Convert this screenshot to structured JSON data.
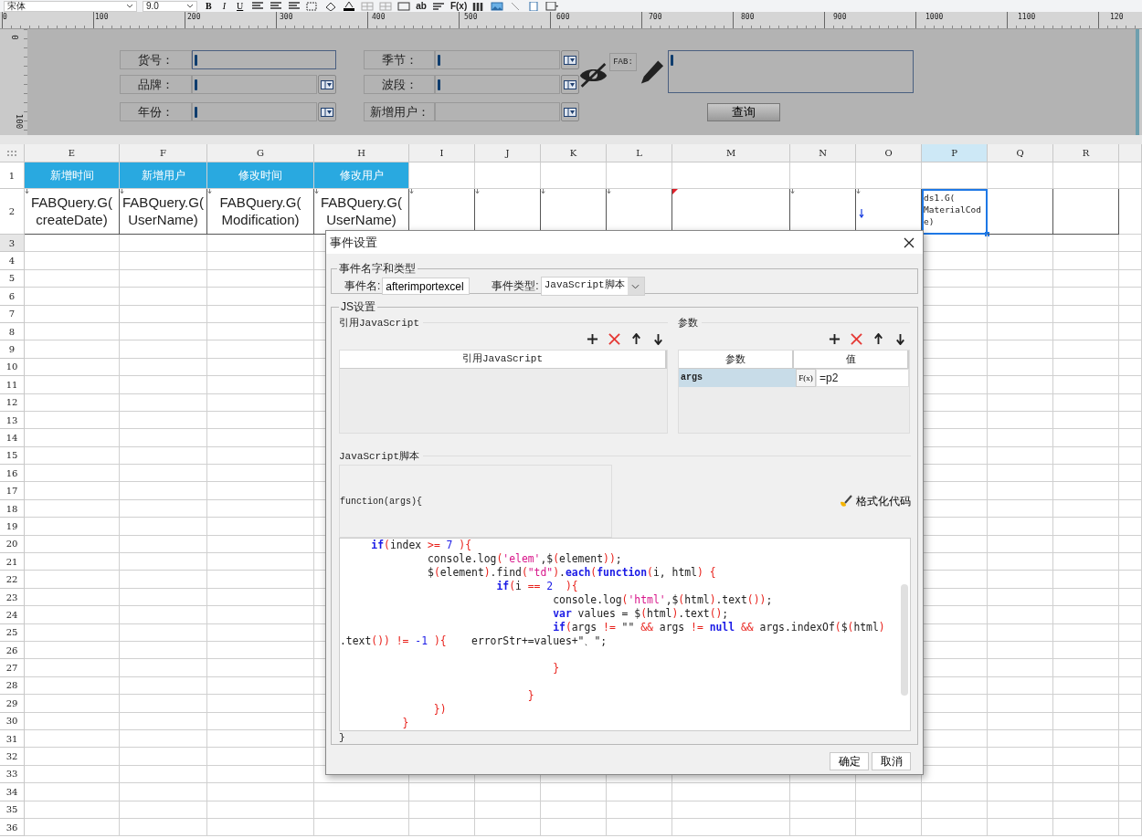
{
  "toolbar": {
    "font": "宋体",
    "size": "9.0",
    "styles": [
      "B",
      "I",
      "U"
    ],
    "formula": "F(x)",
    "text_tool": "ab"
  },
  "ruler": {
    "labels": [
      "0",
      "100",
      "200",
      "300",
      "400",
      "500",
      "600",
      "700",
      "800",
      "900",
      "1000",
      "1100",
      "120"
    ]
  },
  "side_ruler": {
    "labels": [
      "0",
      "100"
    ]
  },
  "form": {
    "fields": [
      {
        "label": "货号：",
        "kind": "text",
        "cursor": true
      },
      {
        "label": "品牌：",
        "kind": "combo",
        "cursor": true
      },
      {
        "label": "年份：",
        "kind": "combo",
        "cursor": true
      },
      {
        "label": "季节：",
        "kind": "combo",
        "cursor": true
      },
      {
        "label": "波段：",
        "kind": "combo",
        "cursor": true
      },
      {
        "label": "新增用户：",
        "kind": "combo",
        "cursor": false
      }
    ],
    "fab_label": "FAB:",
    "query_button": "查询"
  },
  "sheet": {
    "columns": [
      {
        "label": "E",
        "selected": false
      },
      {
        "label": "F",
        "selected": false
      },
      {
        "label": "G",
        "selected": false
      },
      {
        "label": "H",
        "selected": false
      },
      {
        "label": "I",
        "selected": false
      },
      {
        "label": "J",
        "selected": false
      },
      {
        "label": "K",
        "selected": false
      },
      {
        "label": "L",
        "selected": false
      },
      {
        "label": "M",
        "selected": false
      },
      {
        "label": "N",
        "selected": false
      },
      {
        "label": "O",
        "selected": false
      },
      {
        "label": "P",
        "selected": true
      },
      {
        "label": "Q",
        "selected": false
      },
      {
        "label": "R",
        "selected": false
      }
    ],
    "header_row": {
      "number": "1",
      "cells": [
        "新增时间",
        "新增用户",
        "修改时间",
        "修改用户"
      ]
    },
    "formula_row": {
      "number": "2",
      "cells": [
        {
          "text": "FABQuery.G(createDate)",
          "kind": "down",
          "selected": false
        },
        {
          "text": "FABQuery.G(UserName)",
          "kind": "down",
          "selected": false
        },
        {
          "text": "FABQuery.G(Modification)",
          "kind": "down",
          "selected": false
        },
        {
          "text": "FABQuery.G(UserName)",
          "kind": "down",
          "selected": false
        },
        {
          "kind": "down",
          "selected": false
        },
        {
          "kind": "down",
          "selected": false
        },
        {
          "kind": "down",
          "selected": false
        },
        {
          "kind": "down",
          "selected": false
        },
        {
          "kind": "comment",
          "selected": false
        },
        {
          "kind": "down",
          "selected": false
        },
        {
          "kind": "arrow",
          "selected": false
        },
        {
          "text": "ds1.G(MaterialCode)",
          "selected": true
        },
        {
          "selected": false
        },
        {
          "selected": false
        }
      ]
    },
    "empty_rows": [
      "3",
      "4",
      "5",
      "6",
      "7",
      "8",
      "9",
      "10",
      "11",
      "12",
      "13",
      "14",
      "15",
      "16",
      "17",
      "18",
      "19",
      "20",
      "21",
      "22",
      "23",
      "24",
      "25",
      "26",
      "27",
      "28",
      "29",
      "30",
      "31",
      "32",
      "33",
      "34",
      "35",
      "36"
    ]
  },
  "dialog": {
    "title": "事件设置",
    "event_group": {
      "legend": "事件名字和类型",
      "name_label": "事件名:",
      "name_value": "afterimportexcel",
      "type_label": "事件类型:",
      "type_value": "JavaScript脚本"
    },
    "js_group": {
      "legend": "JS设置",
      "ref_section": {
        "title": "引用JavaScript",
        "column": "引用JavaScript"
      },
      "param_section": {
        "title": "参数",
        "columns": [
          "参数",
          "值"
        ],
        "rows": [
          {
            "name": "args",
            "formula": "F(x)",
            "value": "=p2",
            "selected": true
          }
        ]
      },
      "script_title": "JavaScript脚本",
      "function_head": "function(args){",
      "format_button": "格式化代码",
      "code": [
        {
          "tokens": [
            {
              "kind": "keyword",
              "text": "     if"
            },
            {
              "kind": "punct",
              "text": "("
            },
            {
              "kind": "plain",
              "text": "index "
            },
            {
              "kind": "punct",
              "text": ">= "
            },
            {
              "kind": "number",
              "text": "7"
            },
            {
              "kind": "punct",
              "text": " ){"
            }
          ]
        },
        {
          "tokens": [
            {
              "kind": "plain",
              "text": "              console.log"
            },
            {
              "kind": "punct",
              "text": "("
            },
            {
              "kind": "string",
              "text": "'elem'"
            },
            {
              "kind": "plain",
              "text": ",$"
            },
            {
              "kind": "punct",
              "text": "("
            },
            {
              "kind": "plain",
              "text": "element"
            },
            {
              "kind": "punct",
              "text": "))"
            },
            {
              "kind": "plain",
              "text": ";"
            }
          ]
        },
        {
          "tokens": [
            {
              "kind": "plain",
              "text": "              $"
            },
            {
              "kind": "punct",
              "text": "("
            },
            {
              "kind": "plain",
              "text": "element"
            },
            {
              "kind": "punct",
              "text": ")"
            },
            {
              "kind": "plain",
              "text": ".find"
            },
            {
              "kind": "punct",
              "text": "("
            },
            {
              "kind": "string",
              "text": "\"td\""
            },
            {
              "kind": "punct",
              "text": ")"
            },
            {
              "kind": "plain",
              "text": "."
            },
            {
              "kind": "keyword",
              "text": "each"
            },
            {
              "kind": "punct",
              "text": "("
            },
            {
              "kind": "keyword",
              "text": "function"
            },
            {
              "kind": "punct",
              "text": "("
            },
            {
              "kind": "plain",
              "text": "i, html"
            },
            {
              "kind": "punct",
              "text": ")"
            },
            {
              "kind": "punct",
              "text": " {"
            }
          ]
        },
        {
          "tokens": [
            {
              "kind": "keyword",
              "text": "                         if"
            },
            {
              "kind": "punct",
              "text": "("
            },
            {
              "kind": "plain",
              "text": "i "
            },
            {
              "kind": "punct",
              "text": "== "
            },
            {
              "kind": "number",
              "text": "2"
            },
            {
              "kind": "punct",
              "text": "  ){"
            }
          ]
        },
        {
          "tokens": [
            {
              "kind": "plain",
              "text": "                                  console.log"
            },
            {
              "kind": "punct",
              "text": "("
            },
            {
              "kind": "string",
              "text": "'html'"
            },
            {
              "kind": "plain",
              "text": ",$"
            },
            {
              "kind": "punct",
              "text": "("
            },
            {
              "kind": "plain",
              "text": "html"
            },
            {
              "kind": "punct",
              "text": ")"
            },
            {
              "kind": "plain",
              "text": ".text"
            },
            {
              "kind": "punct",
              "text": "())"
            },
            {
              "kind": "plain",
              "text": ";"
            }
          ]
        },
        {
          "tokens": [
            {
              "kind": "keyword",
              "text": "                                  var"
            },
            {
              "kind": "plain",
              "text": " values = $"
            },
            {
              "kind": "punct",
              "text": "("
            },
            {
              "kind": "plain",
              "text": "html"
            },
            {
              "kind": "punct",
              "text": ")"
            },
            {
              "kind": "plain",
              "text": ".text"
            },
            {
              "kind": "punct",
              "text": "()"
            },
            {
              "kind": "plain",
              "text": ";"
            }
          ]
        },
        {
          "tokens": [
            {
              "kind": "keyword",
              "text": "                                  if"
            },
            {
              "kind": "punct",
              "text": "("
            },
            {
              "kind": "plain",
              "text": "args "
            },
            {
              "kind": "punct",
              "text": "!="
            },
            {
              "kind": "plain",
              "text": " \"\" "
            },
            {
              "kind": "punct",
              "text": "&&"
            },
            {
              "kind": "plain",
              "text": " args "
            },
            {
              "kind": "punct",
              "text": "!= "
            },
            {
              "kind": "keyword",
              "text": "null"
            },
            {
              "kind": "punct",
              "text": " &&"
            },
            {
              "kind": "plain",
              "text": " args.indexOf"
            },
            {
              "kind": "punct",
              "text": "("
            },
            {
              "kind": "plain",
              "text": "$"
            },
            {
              "kind": "punct",
              "text": "("
            },
            {
              "kind": "plain",
              "text": "html"
            },
            {
              "kind": "punct",
              "text": ")"
            }
          ]
        },
        {
          "tokens": [
            {
              "kind": "plain",
              "text": ".text"
            },
            {
              "kind": "punct",
              "text": "()) != "
            },
            {
              "kind": "number",
              "text": "-1"
            },
            {
              "kind": "punct",
              "text": " ){"
            },
            {
              "kind": "plain",
              "text": "    errorStr+=values+\"、\";"
            }
          ]
        },
        {
          "blank_before": true,
          "tokens": [
            {
              "kind": "punct",
              "text": "                                  }"
            }
          ]
        },
        {
          "tokens": [
            {
              "kind": "punct",
              "text": "                              }"
            }
          ]
        },
        {
          "tokens": [
            {
              "kind": "punct",
              "text": "               })"
            }
          ]
        },
        {
          "tokens": [
            {
              "kind": "punct",
              "text": "          }"
            }
          ]
        }
      ],
      "function_tail": "}"
    },
    "buttons": [
      "确定",
      "取消"
    ]
  }
}
